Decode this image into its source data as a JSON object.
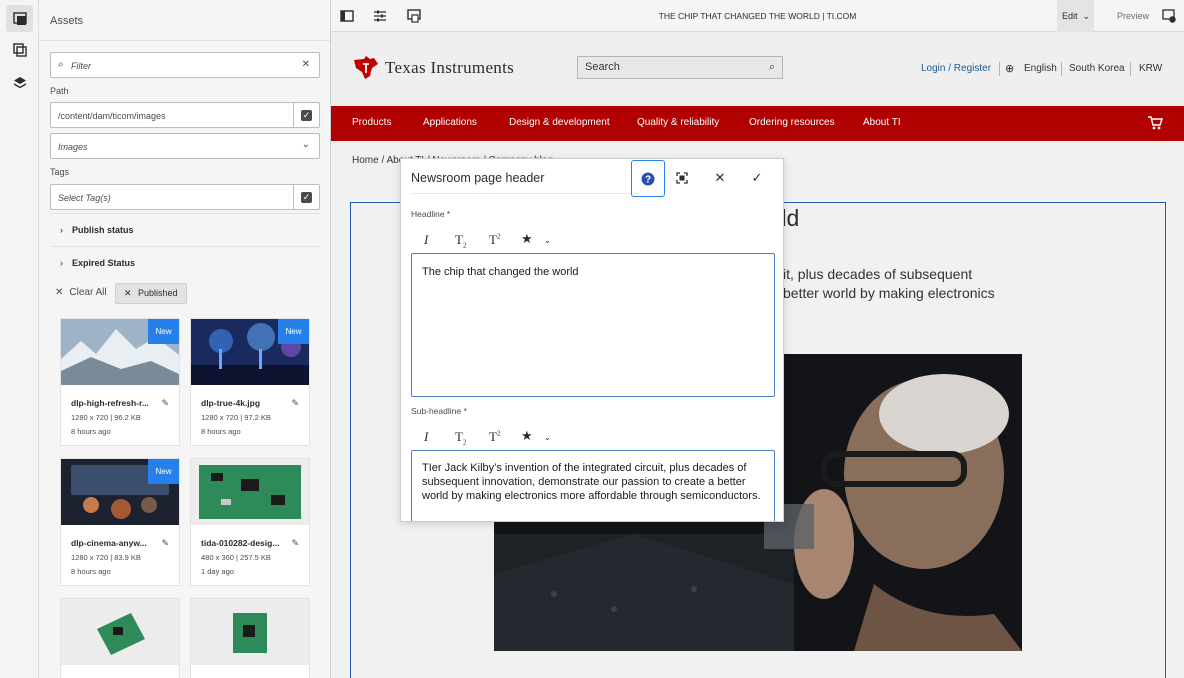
{
  "colors": {
    "accent": "#2680eb",
    "ti_red": "#b00000",
    "link": "#1d5b8e"
  },
  "rail": {
    "icons": [
      "assets-icon",
      "components-icon",
      "layers-icon"
    ]
  },
  "panel": {
    "title": "Assets",
    "filter_placeholder": "Filter",
    "path_label": "Path",
    "path_value": "/content/dam/ticom/images",
    "type_value": "Images",
    "tags_label": "Tags",
    "tags_placeholder": "Select Tag(s)",
    "publish_status": "Publish status",
    "expired_status": "Expired Status",
    "clear_all": "Clear All",
    "chip_label": "Published",
    "cards": [
      {
        "name": "dlp-high-refresh-r...",
        "meta": "1280 x 720 | 96.2 KB",
        "time": "8 hours ago",
        "badge": "New"
      },
      {
        "name": "dlp-true-4k.jpg",
        "meta": "1280 x 720 | 97.2 KB",
        "time": "8 hours ago",
        "badge": "New"
      },
      {
        "name": "dlp-cinema-anyw...",
        "meta": "1280 x 720 | 83.9 KB",
        "time": "8 hours ago",
        "badge": "New"
      },
      {
        "name": "tida-010282-desig...",
        "meta": "480 x 360 | 257.5 KB",
        "time": "1 day ago",
        "badge": ""
      }
    ]
  },
  "toolbar": {
    "page_title": "THE CHIP THAT CHANGED THE WORLD | TI.COM",
    "mode": "Edit",
    "preview": "Preview"
  },
  "site": {
    "logo": "Texas Instruments",
    "search_placeholder": "Search",
    "login_register": "Login / Register",
    "language": "English",
    "country": "South Korea",
    "currency": "KRW",
    "nav": [
      "Products",
      "Applications",
      "Design & development",
      "Quality & reliability",
      "Ordering resources",
      "About TI"
    ],
    "breadcrumb": "Home  /  About TI  /  Newsroom  /  Company blog",
    "hero_heading_partial": "orld",
    "hero_line1_partial": "it, plus decades of subsequent",
    "hero_line2_partial": "better world by making electronics"
  },
  "dialog": {
    "title": "Newsroom page header",
    "headline_label": "Headline *",
    "headline_value": "The chip that changed the world",
    "subheadline_label": "Sub-headline *",
    "subheadline_value": "TIer Jack Kilby’s invention of the integrated circuit, plus decades of subsequent innovation, demonstrate our passion to create a better world by making electronics more affordable through semiconductors."
  }
}
